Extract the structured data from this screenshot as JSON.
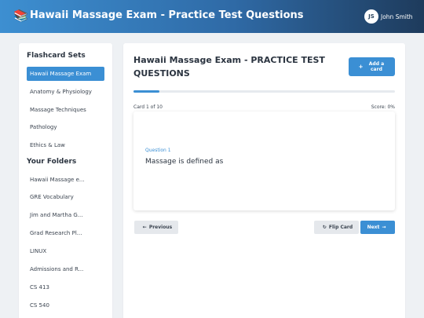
{
  "header": {
    "logo_icon": "📚",
    "title": "Hawaii Massage Exam - Practice Test Questions",
    "user": {
      "initials": "JS",
      "name": "John Smith"
    }
  },
  "sidebar": {
    "sets_heading": "Flashcard Sets",
    "sets": [
      {
        "label": "Hawaii Massage Exam",
        "active": true
      },
      {
        "label": "Anatomy & Physiology"
      },
      {
        "label": "Massage Techniques"
      },
      {
        "label": "Pathology"
      },
      {
        "label": "Ethics & Law"
      }
    ],
    "folders_heading": "Your Folders",
    "folders": [
      {
        "label": "Hawaii Massage e..."
      },
      {
        "label": "GRE Vocabulary"
      },
      {
        "label": "Jim and Martha G..."
      },
      {
        "label": "Grad Research Pl..."
      },
      {
        "label": "LINUX"
      },
      {
        "label": "Admissions and R..."
      },
      {
        "label": "CS 413"
      },
      {
        "label": "CS 540"
      }
    ]
  },
  "main": {
    "title": "Hawaii Massage Exam - PRACTICE TEST QUESTIONS",
    "add_card": {
      "icon": "+",
      "label": "Add a card"
    },
    "progress": 0.1,
    "card_count": "Card 1 of 10",
    "score": "Score: 0%",
    "card": {
      "label": "Question 1",
      "text": "Massage is defined as"
    },
    "buttons": {
      "previous": {
        "icon": "←",
        "label": "Previous"
      },
      "flip": {
        "icon": "↻",
        "label": "Flip Card"
      },
      "next": {
        "icon": "→",
        "label": "Next"
      }
    }
  },
  "colors": {
    "accent": "#3b8fd4",
    "header_dark": "#1e3b5c"
  }
}
